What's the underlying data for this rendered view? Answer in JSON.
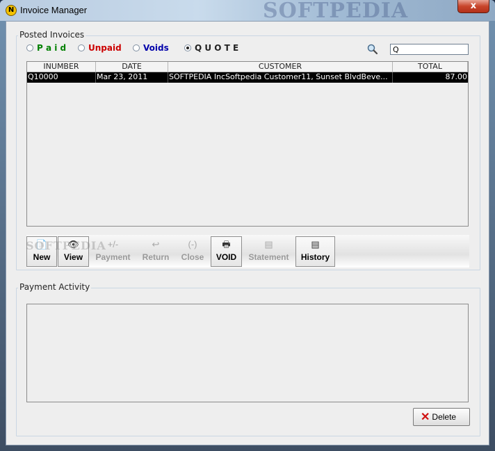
{
  "window": {
    "title": "Invoice Manager",
    "app_icon_letter": "N",
    "watermark": "SOFTPEDIA",
    "close_label": "x"
  },
  "posted_invoices": {
    "group_title": "Posted Invoices",
    "filters": [
      {
        "label": "P a i d",
        "color": "#008000",
        "selected": false
      },
      {
        "label": "Unpaid",
        "color": "#cc0000",
        "selected": false
      },
      {
        "label": "Voids",
        "color": "#0000aa",
        "selected": false
      },
      {
        "label": "Q U O T E",
        "color": "#222222",
        "selected": true
      }
    ],
    "search_icon": "magnifier-icon",
    "search_value": "Q"
  },
  "table": {
    "columns": [
      "INUMBER",
      "DATE",
      "CUSTOMER",
      "TOTAL"
    ],
    "rows": [
      {
        "inumber": "Q10000",
        "date": "Mar 23, 2011",
        "customer": "SOFTPEDIA IncSoftpedia Customer11, Sunset BlvdBeve...",
        "total": "87.00",
        "selected": true
      }
    ]
  },
  "toolbar": {
    "buttons": [
      {
        "label": "New",
        "icon": "new-document-icon",
        "glyph": "📄",
        "enabled": true
      },
      {
        "label": "View",
        "icon": "eye-icon",
        "glyph": "👁",
        "enabled": true
      },
      {
        "label": "Payment",
        "icon": "plus-minus-icon",
        "glyph": "+/-",
        "enabled": false
      },
      {
        "label": "Return",
        "icon": "return-arrow-icon",
        "glyph": "↩",
        "enabled": false
      },
      {
        "label": "Close",
        "icon": "minus-icon",
        "glyph": "(-)",
        "enabled": false
      },
      {
        "label": "VOID",
        "icon": "printer-icon",
        "glyph": "🖶",
        "enabled": true
      },
      {
        "label": "Statement",
        "icon": "statement-icon",
        "glyph": "▤",
        "enabled": false
      },
      {
        "label": "History",
        "icon": "history-icon",
        "glyph": "▤",
        "enabled": true
      }
    ],
    "watermark": "SOFTPEDIA"
  },
  "payment_activity": {
    "group_title": "Payment Activity"
  },
  "actions": {
    "delete_label": "Delete"
  }
}
